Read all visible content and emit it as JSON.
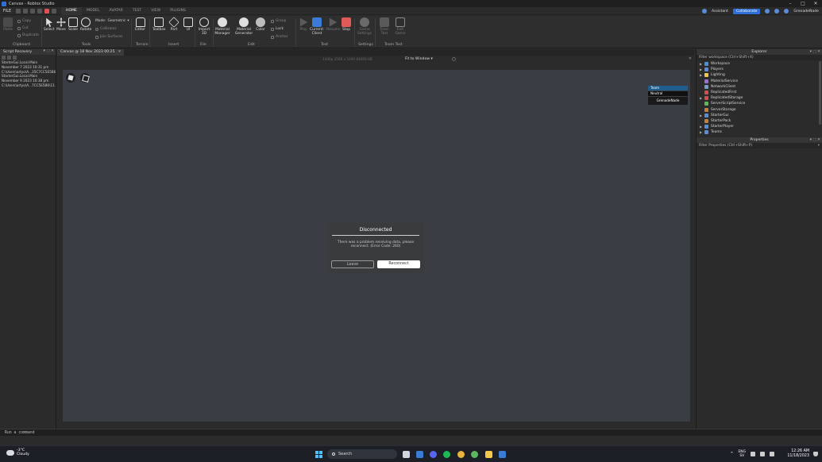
{
  "window": {
    "title": "Canvas - Roblox Studio"
  },
  "menubar": {
    "file_label": "FILE",
    "tabs": [
      "HOME",
      "MODEL",
      "AVATAR",
      "TEST",
      "VIEW",
      "PLUGINS"
    ],
    "active_tab": "HOME",
    "assistant_label": "Assistant",
    "collaborate_label": "Collaborate",
    "username": "GrenadeNade"
  },
  "ribbon": {
    "clipboard": {
      "paste": "Paste",
      "copy": "Copy",
      "cut": "Cut",
      "duplicate": "Duplicate",
      "group": "Clipboard"
    },
    "tools": {
      "select": "Select",
      "move": "Move",
      "scale": "Scale",
      "rotate": "Rotate",
      "mode_label": "Mode:",
      "mode_value": "Geometric",
      "collisions": "Collisions",
      "join_surfaces": "Join Surfaces",
      "group": "Tools"
    },
    "terrain": {
      "editor": "Editor",
      "group": "Terrain"
    },
    "insert": {
      "toolbox": "Toolbox",
      "part": "Part",
      "ui": "UI",
      "group": "Insert"
    },
    "file": {
      "import_3d": "Import 3D",
      "group": "File"
    },
    "edit": {
      "material_manager": "Material Manager",
      "material_generator": "Material Generator",
      "color": "Color",
      "group_item": "Group",
      "lock": "Lock",
      "anchor": "Anchor",
      "group": "Edit"
    },
    "test": {
      "play": "Play",
      "current_client": "Current: Client",
      "resume": "Resume",
      "stop": "Stop",
      "group": "Test"
    },
    "settings": {
      "game_settings": "Game Settings",
      "group": "Settings"
    },
    "team_test": {
      "team_test": "Team Test",
      "exit_game": "Exit Game",
      "group": "Team Test"
    }
  },
  "left_panel": {
    "title": "Script Recovery",
    "entries": [
      "StarterGui.Local.Main",
      "November 7 2023 10:31 pm",
      "C:\\Users\\artyo\\A...35C7CC5E5B6",
      "StarterGui.Local.Main",
      "November 9 2023 10:38 pm",
      "C:\\Users\\artyo\\A...7CC5E5B6\\11..."
    ]
  },
  "doc": {
    "tab_label": "Canvas @ 18 Nov 2023 00:25",
    "resolution": "1440p  2560 x 1440  84000 KB",
    "fit_label": "Fit to Window"
  },
  "viewport": {
    "teams": {
      "team_label": "Team",
      "neutral_label": "Neutral",
      "player_name": "GrenadeNade"
    },
    "dialog": {
      "title": "Disconnected",
      "message": "There was a problem receiving data, please reconnect. (Error Code: 260)",
      "leave_label": "Leave",
      "reconnect_label": "Reconnect"
    }
  },
  "explorer": {
    "title": "Explorer",
    "filter_placeholder": "Filter workspace (Ctrl+Shift+X)",
    "items": [
      {
        "name": "Workspace",
        "expand": true,
        "color": "#4a90d9"
      },
      {
        "name": "Players",
        "expand": true,
        "color": "#5b8dd6"
      },
      {
        "name": "Lighting",
        "expand": true,
        "color": "#f2c94c"
      },
      {
        "name": "MaterialService",
        "expand": false,
        "color": "#9b6bd6"
      },
      {
        "name": "NetworkClient",
        "expand": false,
        "color": "#7a9cc6"
      },
      {
        "name": "ReplicatedFirst",
        "expand": false,
        "color": "#d05050"
      },
      {
        "name": "ReplicatedStorage",
        "expand": true,
        "color": "#d05050"
      },
      {
        "name": "ServerScriptService",
        "expand": false,
        "color": "#5cb85c"
      },
      {
        "name": "ServerStorage",
        "expand": false,
        "color": "#c08040"
      },
      {
        "name": "StarterGui",
        "expand": true,
        "color": "#5b8dd6"
      },
      {
        "name": "StarterPack",
        "expand": false,
        "color": "#c08040"
      },
      {
        "name": "StarterPlayer",
        "expand": true,
        "color": "#5b8dd6"
      },
      {
        "name": "Teams",
        "expand": true,
        "color": "#5b8dd6"
      }
    ]
  },
  "properties": {
    "title": "Properties",
    "filter_placeholder": "Filter Properties (Ctrl+Shift+P)"
  },
  "command_bar": {
    "placeholder": "Run a command"
  },
  "taskbar": {
    "weather_temp": "-3°C",
    "weather_desc": "Cloudy",
    "search_label": "Search",
    "lang": "ENG",
    "lang_sub": "SV",
    "time": "12:26 AM",
    "date": "11/18/2023"
  }
}
